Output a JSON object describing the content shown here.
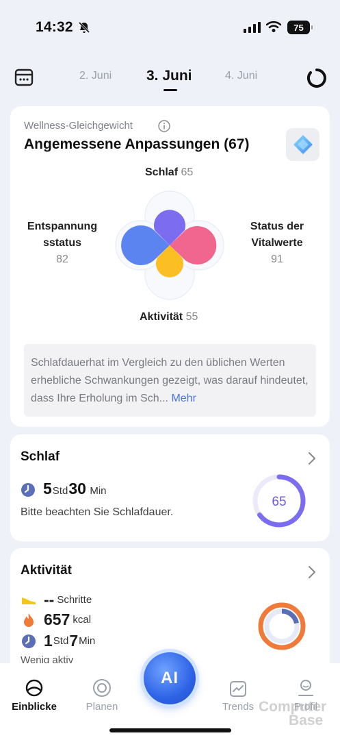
{
  "status_bar": {
    "time": "14:32",
    "battery": "75"
  },
  "date_nav": {
    "prev": "2. Juni",
    "current": "3. Juni",
    "next": "4. Juni"
  },
  "wellness": {
    "label": "Wellness-Gleichgewicht",
    "title": "Angemessene Anpassungen (67)",
    "petals": {
      "top": {
        "label": "Schlaf",
        "value": "65",
        "color": "#7b6cf0"
      },
      "bottom": {
        "label": "Aktivität",
        "value": "55",
        "color": "#fbbf24"
      },
      "left": {
        "label_line1": "Entspannung",
        "label_line2": "sstatus",
        "value": "82",
        "color": "#5b84f0"
      },
      "right": {
        "label_line1": "Status der",
        "label_line2": "Vitalwerte",
        "value": "91",
        "color": "#f0668e"
      }
    },
    "summary": "Schlafdauerhat im Vergleich zu den üblichen Werten erhebliche Schwankungen gezeigt, was darauf hindeutet, dass Ihre Erholung im Sch...",
    "more": "Mehr"
  },
  "sleep": {
    "title": "Schlaf",
    "hours": "5",
    "hours_unit": "Std",
    "minutes": "30",
    "minutes_unit": "Min",
    "note": "Bitte beachten Sie Schlafdauer.",
    "score": "65",
    "score_fraction": 0.65,
    "ring_color": "#7b6cf0"
  },
  "activity": {
    "title": "Aktivität",
    "steps": "--",
    "steps_unit": "Schritte",
    "kcal": "657",
    "kcal_unit": "kcal",
    "hours": "1",
    "hours_unit": "Std",
    "minutes": "7",
    "minutes_unit": "Min",
    "partial_text": "Wenig aktiv"
  },
  "nav": {
    "items": [
      {
        "label": "Einblicke",
        "icon": "insights-icon",
        "active": true
      },
      {
        "label": "Planen",
        "icon": "plan-icon",
        "active": false
      },
      {
        "label": "Trends",
        "icon": "trends-icon",
        "active": false
      },
      {
        "label": "Profil",
        "icon": "profile-icon",
        "active": false
      }
    ],
    "center": "AI"
  },
  "watermark": {
    "line1": "Computer",
    "line2": "Base"
  }
}
